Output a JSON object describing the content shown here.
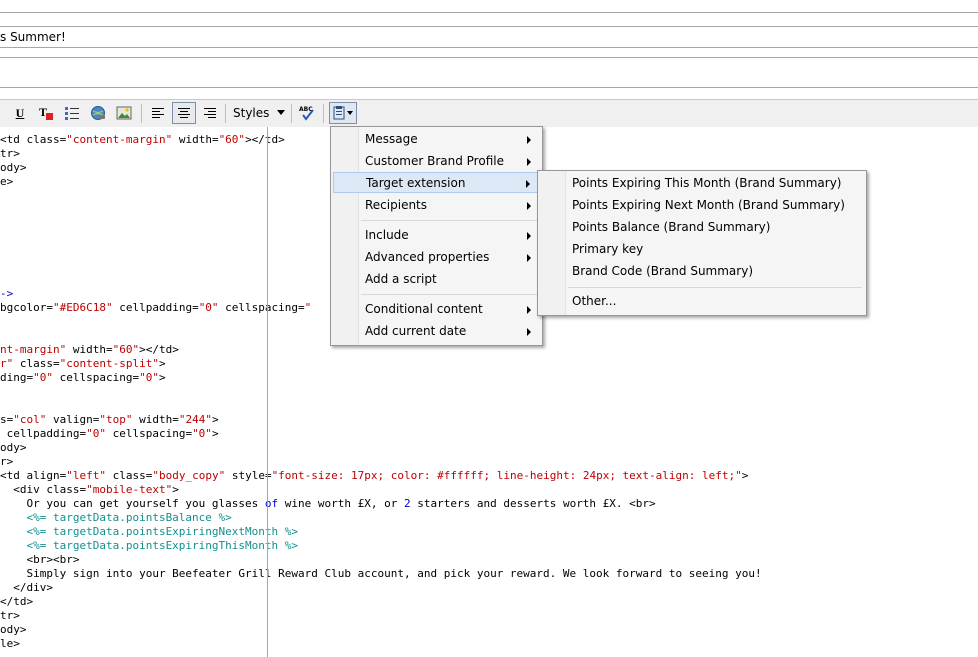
{
  "header": {
    "subject_value": "s Summer!"
  },
  "toolbar": {
    "styles_label": "Styles"
  },
  "code": {
    "lines": [
      [
        [
          "",
          "<td class="
        ],
        [
          "r",
          "\"content-margin\""
        ],
        [
          "",
          " width="
        ],
        [
          "r",
          "\"60\""
        ],
        [
          "",
          "></td>"
        ]
      ],
      [
        [
          "",
          "tr>"
        ]
      ],
      [
        [
          "",
          "ody>"
        ]
      ],
      [
        [
          "",
          "e>"
        ]
      ],
      [],
      [],
      [],
      [],
      [],
      [],
      [],
      [
        [
          "b",
          "->"
        ]
      ],
      [
        [
          "",
          "bgcolor="
        ],
        [
          "r",
          "\"#ED6C18\""
        ],
        [
          "",
          " cellpadding="
        ],
        [
          "r",
          "\"0\""
        ],
        [
          "",
          " cellspacing="
        ],
        [
          "r",
          "\""
        ]
      ],
      [],
      [],
      [
        [
          "r",
          "nt-margin\""
        ],
        [
          "",
          " width="
        ],
        [
          "r",
          "\"60\""
        ],
        [
          "",
          "></td>"
        ]
      ],
      [
        [
          "r",
          "r\""
        ],
        [
          "",
          " class="
        ],
        [
          "r",
          "\"content-split\""
        ],
        [
          "",
          ">"
        ]
      ],
      [
        [
          "",
          "ding="
        ],
        [
          "r",
          "\"0\""
        ],
        [
          "",
          " cellspacing="
        ],
        [
          "r",
          "\"0\""
        ],
        [
          "",
          ">"
        ]
      ],
      [],
      [],
      [
        [
          "",
          "s="
        ],
        [
          "r",
          "\"col\""
        ],
        [
          "",
          " valign="
        ],
        [
          "r",
          "\"top\""
        ],
        [
          "",
          " width="
        ],
        [
          "r",
          "\"244\""
        ],
        [
          "",
          ">"
        ]
      ],
      [
        [
          "",
          " cellpadding="
        ],
        [
          "r",
          "\"0\""
        ],
        [
          "",
          " cellspacing="
        ],
        [
          "r",
          "\"0\""
        ],
        [
          "",
          ">"
        ]
      ],
      [
        [
          "",
          "ody>"
        ]
      ],
      [
        [
          "",
          "r>"
        ]
      ],
      [
        [
          "",
          "<td align="
        ],
        [
          "r",
          "\"left\""
        ],
        [
          "",
          " class="
        ],
        [
          "r",
          "\"body_copy\""
        ],
        [
          "",
          " style="
        ],
        [
          "r",
          "\"font-size: 17px; color: #ffffff; line-height: 24px; text-align: left;\""
        ],
        [
          "",
          ">"
        ]
      ],
      [
        [
          "",
          "  <div class="
        ],
        [
          "r",
          "\"mobile-text\""
        ],
        [
          "",
          ">"
        ]
      ],
      [
        [
          "",
          "    Or you can get yourself you glasses "
        ],
        [
          "b",
          "of"
        ],
        [
          "",
          " wine worth £X, or "
        ],
        [
          "b",
          "2"
        ],
        [
          "",
          " starters and desserts worth £X. <br>"
        ]
      ],
      [
        [
          "t",
          "    <%= targetData.pointsBalance %>"
        ]
      ],
      [
        [
          "t",
          "    <%= targetData.pointsExpiringNextMonth %>"
        ]
      ],
      [
        [
          "t",
          "    <%= targetData.pointsExpiringThisMonth %>"
        ]
      ],
      [
        [
          "",
          "    <br><br>"
        ]
      ],
      [
        [
          "",
          "    Simply sign into your Beefeater Grill Reward Club account, and pick your reward. We look forward to seeing you!"
        ]
      ],
      [
        [
          "",
          "  </div>"
        ]
      ],
      [
        [
          "",
          "</td>"
        ]
      ],
      [
        [
          "",
          "tr>"
        ]
      ],
      [
        [
          "",
          "ody>"
        ]
      ],
      [
        [
          "",
          "le>"
        ]
      ]
    ]
  },
  "context_menu": {
    "items": [
      "Message",
      "Customer Brand Profile",
      "Target extension",
      "Recipients",
      "Include",
      "Advanced properties",
      "Add a script",
      "Conditional content",
      "Add current date"
    ]
  },
  "submenu": {
    "items": [
      "Points Expiring This Month (Brand Summary)",
      "Points Expiring Next Month (Brand Summary)",
      "Points Balance (Brand Summary)",
      "Primary key",
      "Brand Code (Brand Summary)",
      "Other..."
    ]
  },
  "colors": {
    "string": "#c00000",
    "keyword": "#0000c8",
    "template_tag": "#138f8f",
    "menu_highlight": "#dde8f6"
  }
}
